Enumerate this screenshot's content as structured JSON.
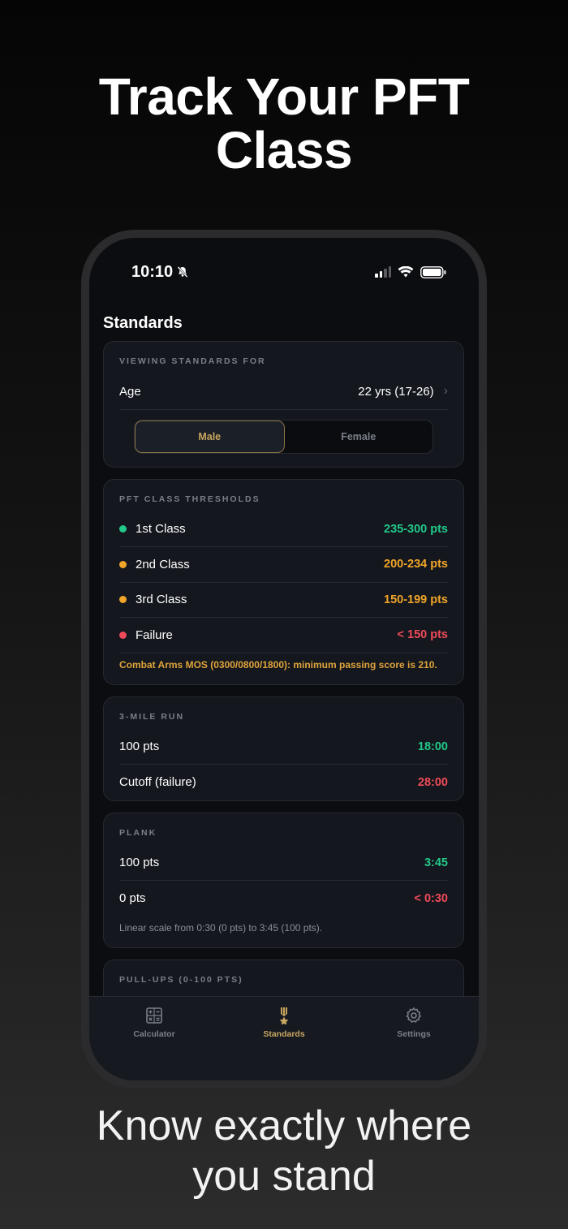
{
  "headline": {
    "line1": "Track Your PFT",
    "line2": "Class"
  },
  "subline": {
    "line1": "Know exactly where",
    "line2": "you stand"
  },
  "status_bar": {
    "time": "10:10",
    "signal_bars_active": 2,
    "signal_bars_total": 4
  },
  "screen_title": "Standards",
  "viewing": {
    "label": "VIEWING STANDARDS FOR",
    "age_label": "Age",
    "age_value": "22 yrs (17-26)",
    "segment": {
      "options": [
        "Male",
        "Female"
      ],
      "selected": "Male"
    }
  },
  "thresholds": {
    "label": "PFT CLASS THRESHOLDS",
    "rows": [
      {
        "name": "1st Class",
        "value": "235-300 pts",
        "color": "#22c98a"
      },
      {
        "name": "2nd Class",
        "value": "200-234 pts",
        "color": "#f0a52a"
      },
      {
        "name": "3rd Class",
        "value": "150-199 pts",
        "color": "#f0a52a"
      },
      {
        "name": "Failure",
        "value": "< 150 pts",
        "color": "#f04a5a"
      }
    ],
    "note": "Combat Arms MOS (0300/0800/1800): minimum passing score is 210."
  },
  "run": {
    "label": "3-MILE RUN",
    "rows": [
      {
        "name": "100 pts",
        "value": "18:00",
        "color": "#22c98a"
      },
      {
        "name": "Cutoff (failure)",
        "value": "28:00",
        "color": "#f04a5a"
      }
    ]
  },
  "plank": {
    "label": "PLANK",
    "rows": [
      {
        "name": "100 pts",
        "value": "3:45",
        "color": "#22c98a"
      },
      {
        "name": "0 pts",
        "value": "< 0:30",
        "color": "#f04a5a"
      }
    ],
    "note": "Linear scale from 0:30 (0 pts) to 3:45 (100 pts)."
  },
  "pullups": {
    "label": "PULL-UPS (0-100 PTS)"
  },
  "tabbar": {
    "tabs": [
      {
        "label": "Calculator",
        "icon": "calculator-icon",
        "active": false
      },
      {
        "label": "Standards",
        "icon": "medal-icon",
        "active": true
      },
      {
        "label": "Settings",
        "icon": "gear-icon",
        "active": false
      }
    ]
  },
  "colors": {
    "accent": "#c8a561",
    "good": "#22c98a",
    "warn": "#f0a52a",
    "bad": "#f04a5a"
  }
}
